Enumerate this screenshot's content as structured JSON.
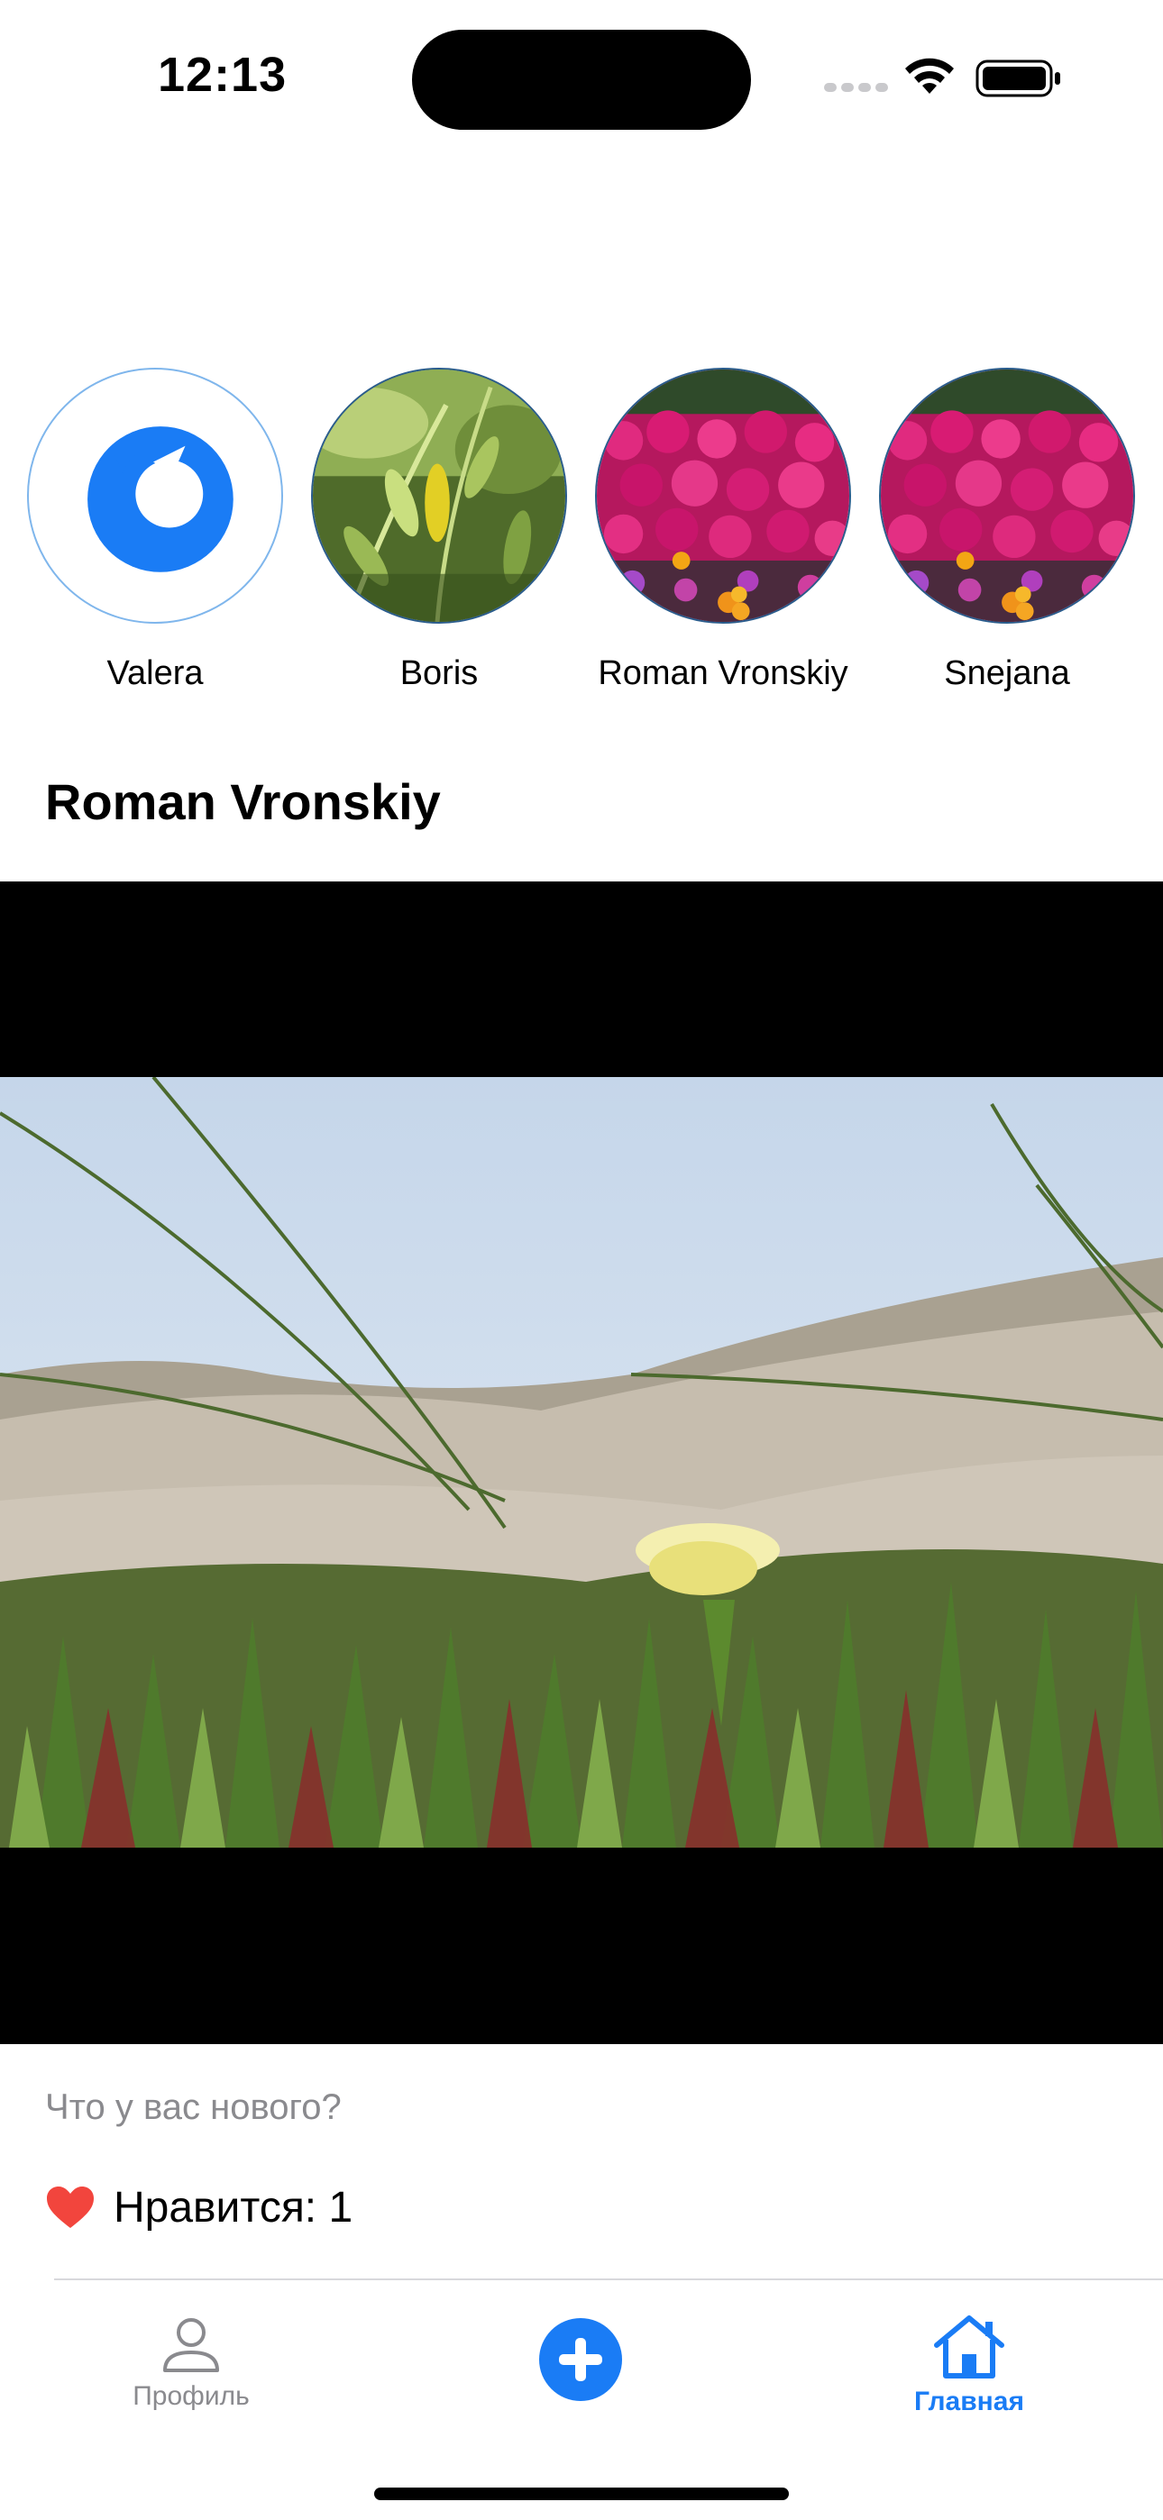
{
  "status_bar": {
    "time": "12:13"
  },
  "stories": [
    {
      "name": "Valera",
      "avatar": "app-logo-icon"
    },
    {
      "name": "Boris",
      "avatar": "leaves-photo"
    },
    {
      "name": "Roman Vronskiy",
      "avatar": "flowers-photo"
    },
    {
      "name": "Snejana",
      "avatar": "flowers-photo"
    }
  ],
  "post": {
    "author": "Roman Vronskiy",
    "image": "grass-flower-photo",
    "caption_placeholder": "Что у вас нового?",
    "likes_label": "Нравится: 1"
  },
  "tab_bar": {
    "profile_label": "Профиль",
    "home_label": "Главная",
    "add_icon": "plus-circle-icon"
  },
  "colors": {
    "accent": "#1a7cf5",
    "secondary_text": "#8a8a8e",
    "like": "#f2453d"
  }
}
